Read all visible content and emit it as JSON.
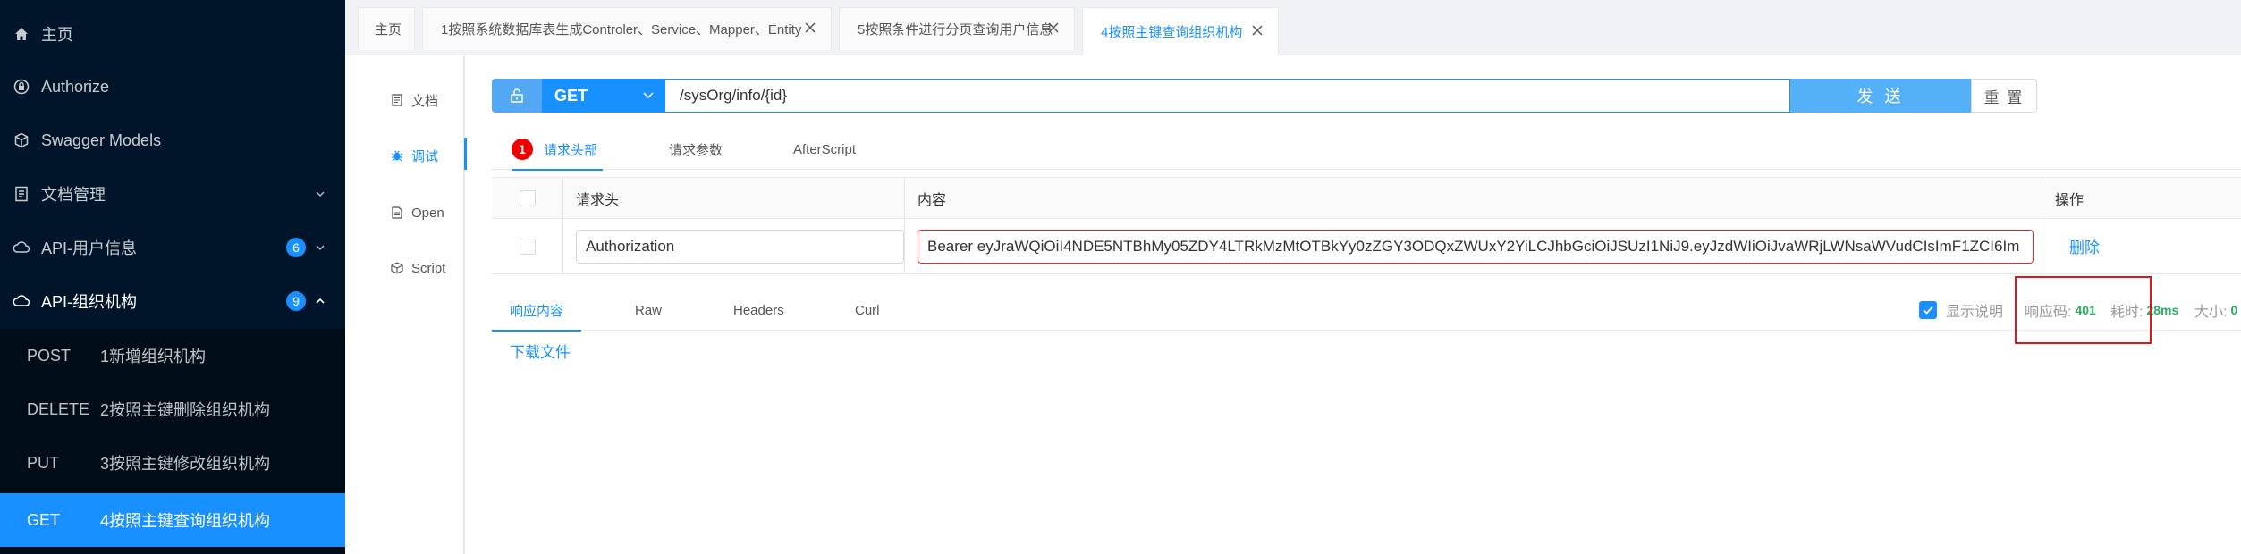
{
  "sidebar": {
    "items": [
      {
        "label": "主页",
        "icon": "home-icon"
      },
      {
        "label": "Authorize",
        "icon": "lock-icon"
      },
      {
        "label": "Swagger Models",
        "icon": "cube-icon"
      },
      {
        "label": "文档管理",
        "icon": "document-icon"
      },
      {
        "label": "API-用户信息",
        "icon": "cloud-icon",
        "badge": "6"
      },
      {
        "label": "API-组织机构",
        "icon": "cloud-icon",
        "badge": "9"
      }
    ],
    "submenu": [
      {
        "method": "POST",
        "label": "1新增组织机构"
      },
      {
        "method": "DELETE",
        "label": "2按照主键删除组织机构"
      },
      {
        "method": "PUT",
        "label": "3按照主键修改组织机构"
      },
      {
        "method": "GET",
        "label": "4按照主键查询组织机构"
      }
    ]
  },
  "tabs": [
    {
      "label": "主页"
    },
    {
      "label": "1按照系统数据库表生成Controler、Service、Mapper、Entity"
    },
    {
      "label": "5按照条件进行分页查询用户信息"
    },
    {
      "label": "4按照主键查询组织机构"
    }
  ],
  "subnav": [
    {
      "label": "文档",
      "icon": "document-icon"
    },
    {
      "label": "调试",
      "icon": "bug-icon"
    },
    {
      "label": "Open",
      "icon": "file-icon"
    },
    {
      "label": "Script",
      "icon": "code-icon"
    }
  ],
  "request": {
    "method": "GET",
    "url": "/sysOrg/info/{id}",
    "send_label": "发 送",
    "reset_label": "重 置"
  },
  "req_tabs": [
    {
      "label": "请求头部",
      "badge": "1"
    },
    {
      "label": "请求参数"
    },
    {
      "label": "AfterScript"
    }
  ],
  "header_table": {
    "columns": [
      "请求头",
      "内容",
      "操作"
    ],
    "rows": [
      {
        "name": "Authorization",
        "value": "Bearer eyJraWQiOiI4NDE5NTBhMy05ZDY4LTRkMzMtOTBkYy0zZGY3ODQxZWUxY2YiLCJhbGciOiJSUzI1NiJ9.eyJzdWIiOiJvaWRjLWNsaWVudCIsImF1ZCI6Im",
        "action": "删除"
      }
    ]
  },
  "resp_tabs": [
    {
      "label": "响应内容"
    },
    {
      "label": "Raw"
    },
    {
      "label": "Headers"
    },
    {
      "label": "Curl"
    }
  ],
  "response": {
    "show_desc_label": "显示说明",
    "code_label": "响应码:",
    "code_value": "401",
    "time_label": "耗时:",
    "time_value": "28ms",
    "size_label": "大小:",
    "size_value": "0",
    "download_label": "下载文件"
  },
  "colors": {
    "accent": "#1890ff",
    "sidebar_bg": "#001529",
    "highlight_box": "#e8131b",
    "ok_green": "#27ae60"
  }
}
